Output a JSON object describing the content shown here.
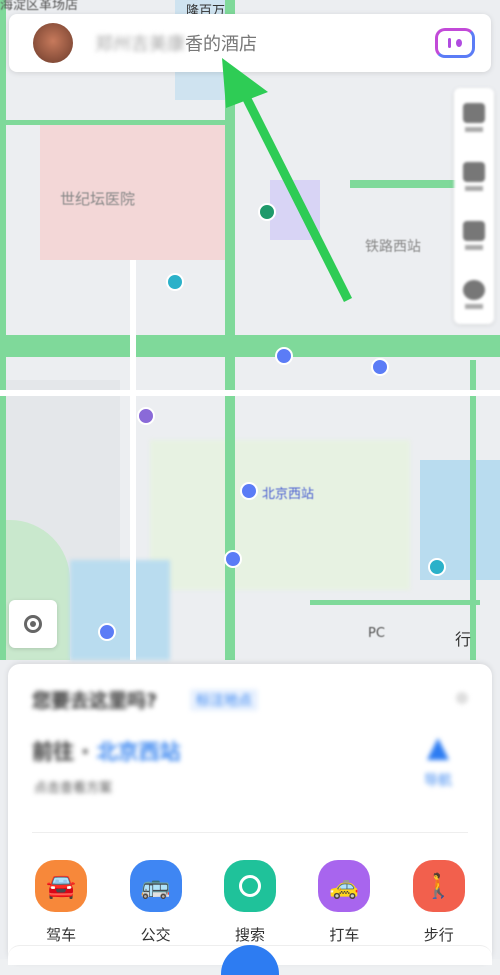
{
  "search": {
    "placeholder_blurred": "郑州吉美康",
    "text": "香的酒店"
  },
  "map_labels": [
    "海淀区革场店",
    "隆百万",
    "世纪坛医院",
    "北京西站",
    "铁路西站",
    "行",
    "PC"
  ],
  "panel": {
    "question": "您要去这里吗?",
    "question_tag": "标注地点",
    "go_prefix": "前往 · ",
    "destination": "北京西站",
    "subtitle": "点击查看方案",
    "nav_label": "导航"
  },
  "modes": [
    {
      "label": "驾车",
      "icon": "car-icon",
      "color": "#f7883a"
    },
    {
      "label": "公交",
      "icon": "bus-icon",
      "color": "#3f86f3"
    },
    {
      "label": "搜索",
      "icon": "search-icon",
      "color": "#1fc29a"
    },
    {
      "label": "打车",
      "icon": "taxi-icon",
      "color": "#a865ee"
    },
    {
      "label": "步行",
      "icon": "walk-icon",
      "color": "#f2604d"
    }
  ],
  "colors": {
    "accent": "#3a86f0",
    "annotation_arrow": "#2ecc55"
  }
}
